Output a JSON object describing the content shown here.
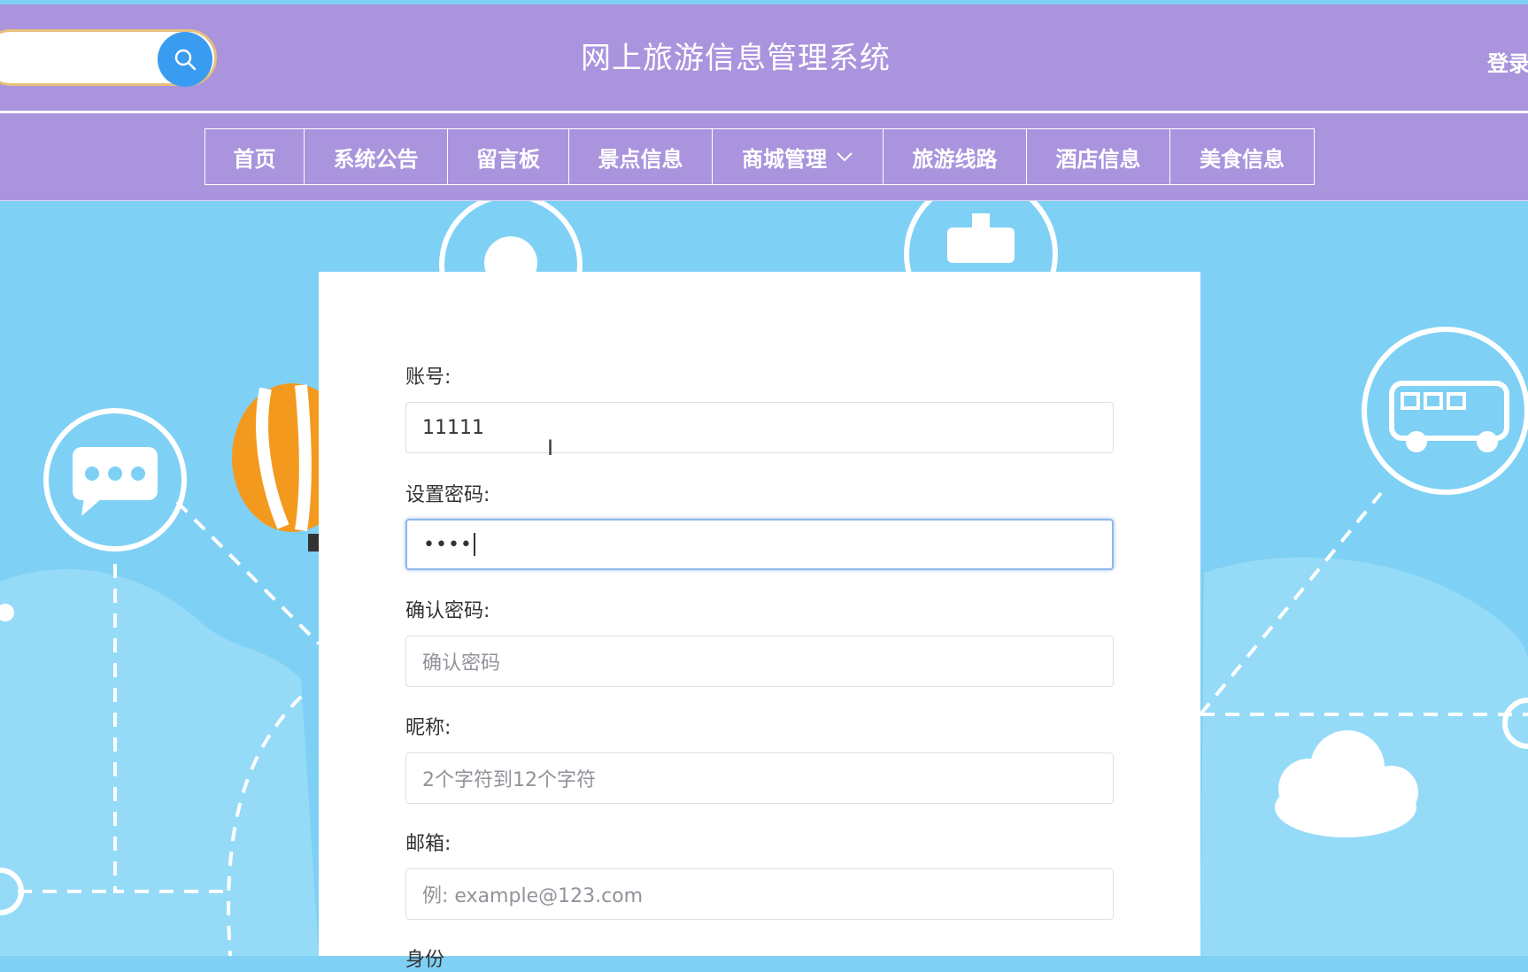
{
  "header": {
    "title": "网上旅游信息管理系统",
    "login": "登录",
    "search_value": "",
    "search_icon": "search-icon"
  },
  "nav": {
    "items": [
      {
        "label": "首页"
      },
      {
        "label": "系统公告"
      },
      {
        "label": "留言板"
      },
      {
        "label": "景点信息"
      },
      {
        "label": "商城管理",
        "has_dropdown": true
      },
      {
        "label": "旅游线路"
      },
      {
        "label": "酒店信息"
      },
      {
        "label": "美食信息"
      }
    ]
  },
  "form": {
    "account_label": "账号:",
    "account_value": "11111",
    "password_label": "设置密码:",
    "password_value": "••••",
    "confirm_label": "确认密码:",
    "confirm_placeholder": "确认密码",
    "nickname_label": "昵称:",
    "nickname_placeholder": "2个字符到12个字符",
    "email_label": "邮箱:",
    "email_placeholder": "例: example@123.com",
    "identity_label": "身份"
  },
  "colors": {
    "header_bg": "#aa94dd",
    "page_bg": "#7fd0f5",
    "search_button": "#3a9cf0",
    "focus_border": "#8cb7ea"
  }
}
